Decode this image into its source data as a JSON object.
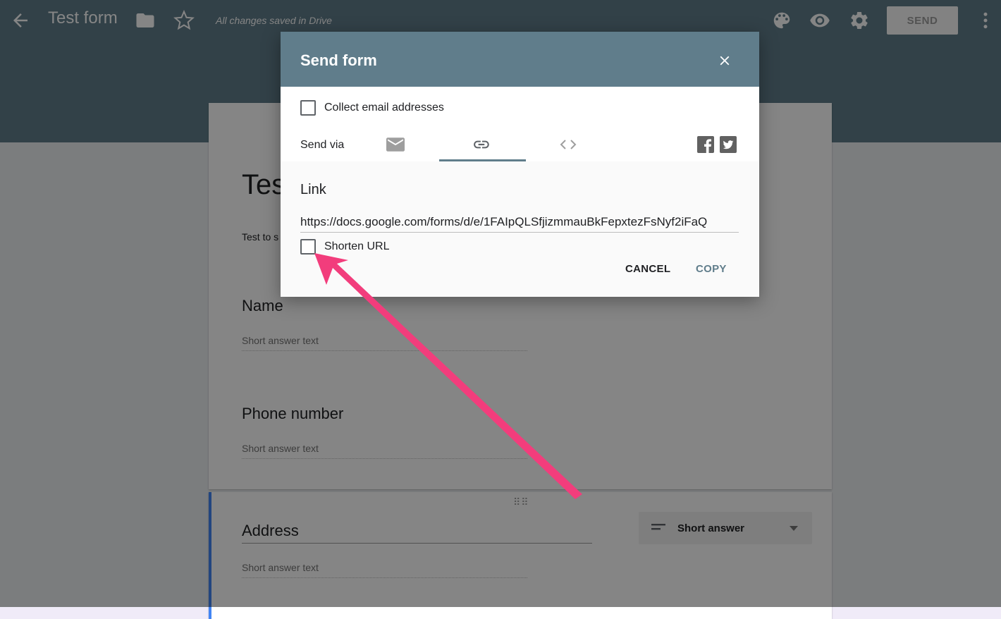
{
  "header": {
    "title": "Test form",
    "saved_status": "All changes saved in Drive",
    "send_label": "SEND"
  },
  "form": {
    "title": "Tes",
    "description": "Test to s",
    "questions": [
      {
        "title": "Name",
        "placeholder": "Short answer text"
      },
      {
        "title": "Phone number",
        "placeholder": "Short answer text"
      },
      {
        "title": "Address",
        "placeholder": "Short answer text"
      }
    ],
    "question_type": "Short answer"
  },
  "dialog": {
    "title": "Send form",
    "collect_email_label": "Collect email addresses",
    "send_via_label": "Send via",
    "link_section_title": "Link",
    "link_url": "https://docs.google.com/forms/d/e/1FAIpQLSfjizmmauBkFepxtezFsNyf2iFaQ",
    "shorten_url_label": "Shorten URL",
    "cancel_label": "CANCEL",
    "copy_label": "COPY"
  },
  "colors": {
    "header_bg": "#607d8b",
    "accent": "#607d8b",
    "arrow": "#ff4081",
    "active_question_bar": "#4285f4"
  }
}
